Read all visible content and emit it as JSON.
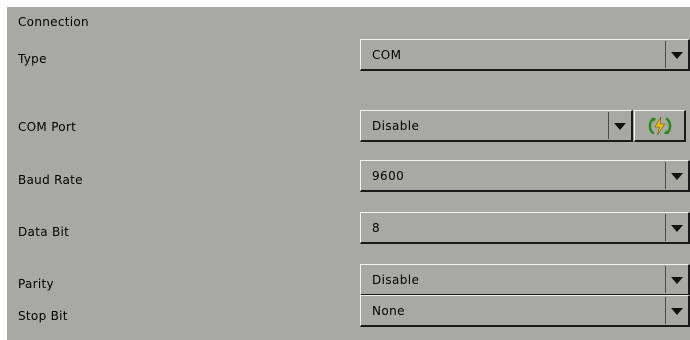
{
  "section_title": "Connection",
  "fields": {
    "type": {
      "label": "Type",
      "value": "COM"
    },
    "com_port": {
      "label": "COM Port",
      "value": "Disable"
    },
    "baud_rate": {
      "label": "Baud Rate",
      "value": "9600"
    },
    "data_bit": {
      "label": "Data Bit",
      "value": "8"
    },
    "parity": {
      "label": "Parity",
      "value": "Disable"
    },
    "stop_bit": {
      "label": "Stop Bit",
      "value": "None"
    }
  },
  "icons": {
    "dropdown": "chevron-down-icon",
    "refresh": "refresh-icon"
  },
  "colors": {
    "panel_background": "#a8a9a5",
    "refresh_arrows": "#2e8b1e",
    "refresh_bolt": "#f2c200"
  }
}
